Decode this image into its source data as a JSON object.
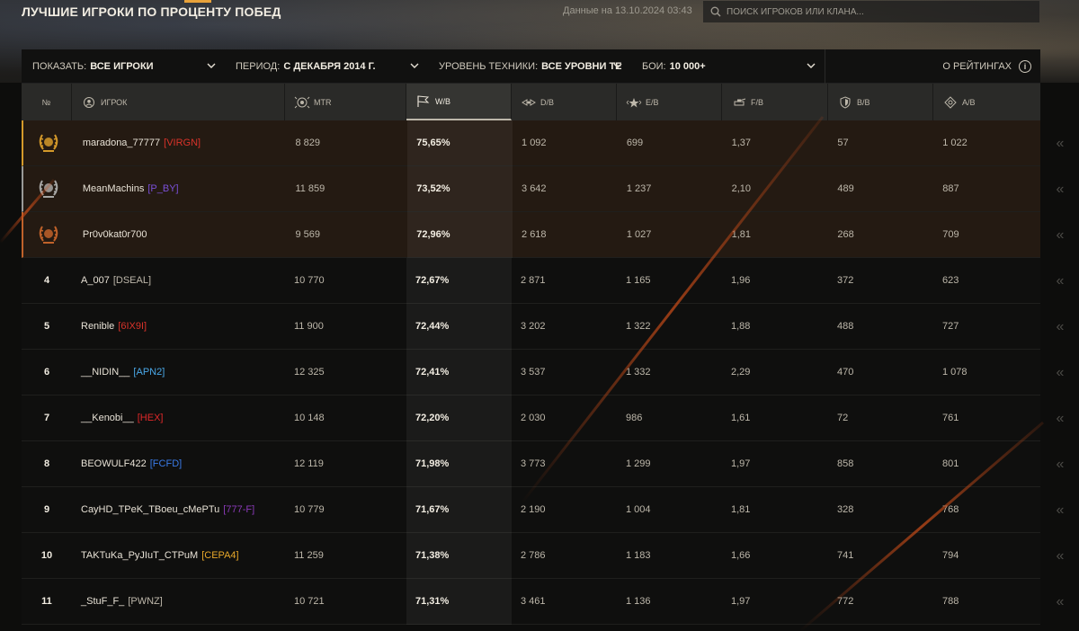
{
  "header": {
    "title": "ЛУЧШИЕ ИГРОКИ ПО ПРОЦЕНТУ ПОБЕД",
    "data_date": "Данные на 13.10.2024 03:43",
    "search_placeholder": "ПОИСК ИГРОКОВ ИЛИ КЛАНА..."
  },
  "filters": {
    "show_label": "ПОКАЗАТЬ:",
    "show_value": "ВСЕ ИГРОКИ",
    "period_label": "ПЕРИОД:",
    "period_value": "С ДЕКАБРЯ 2014 Г.",
    "tier_label": "УРОВЕНЬ ТЕХНИКИ:",
    "tier_value": "ВСЕ УРОВНИ ТЕ",
    "battles_label": "БОИ:",
    "battles_value": "10 000+",
    "about_ratings": "О РЕЙТИНГАХ"
  },
  "columns": {
    "rank": "№",
    "player": "ИГРОК",
    "mtr": "MTR",
    "wb": "W/B",
    "db": "D/B",
    "eb": "E/B",
    "fb": "F/B",
    "bb": "B/B",
    "ab": "A/B"
  },
  "colors": {
    "gold": "#d59a2a",
    "silver": "#9a9a98",
    "bronze": "#c0622a",
    "accent_streak": "#c24a18"
  },
  "rows": [
    {
      "rank": "",
      "medal": "gold-laurel-icon",
      "name": "maradona_77777",
      "clan": "[VIRGN]",
      "clan_color": "#d9332a",
      "mtr": "8 829",
      "wb": "75,65%",
      "db": "1 092",
      "eb": "699",
      "fb": "1,37",
      "bb": "57",
      "ab": "1 022"
    },
    {
      "rank": "",
      "medal": "silver-laurel-icon",
      "name": "MeanMachins",
      "clan": "[P_BY]",
      "clan_color": "#7a4fd8",
      "mtr": "11 859",
      "wb": "73,52%",
      "db": "3 642",
      "eb": "1 237",
      "fb": "2,10",
      "bb": "489",
      "ab": "887"
    },
    {
      "rank": "",
      "medal": "bronze-laurel-icon",
      "name": "Pr0v0kat0r700",
      "clan": "",
      "clan_color": "#bdb7aa",
      "mtr": "9 569",
      "wb": "72,96%",
      "db": "2 618",
      "eb": "1 027",
      "fb": "1,81",
      "bb": "268",
      "ab": "709"
    },
    {
      "rank": "4",
      "medal": "",
      "name": "A_007",
      "clan": "[DSEAL]",
      "clan_color": "#bdb7aa",
      "mtr": "10 770",
      "wb": "72,67%",
      "db": "2 871",
      "eb": "1 165",
      "fb": "1,96",
      "bb": "372",
      "ab": "623"
    },
    {
      "rank": "5",
      "medal": "",
      "name": "Renible",
      "clan": "[6IX9I]",
      "clan_color": "#d9332a",
      "mtr": "11 900",
      "wb": "72,44%",
      "db": "3 202",
      "eb": "1 322",
      "fb": "1,88",
      "bb": "488",
      "ab": "727"
    },
    {
      "rank": "6",
      "medal": "",
      "name": "__NIDIN__",
      "clan": "[APN2]",
      "clan_color": "#4aa8e8",
      "mtr": "12 325",
      "wb": "72,41%",
      "db": "3 537",
      "eb": "1 332",
      "fb": "2,29",
      "bb": "470",
      "ab": "1 078"
    },
    {
      "rank": "7",
      "medal": "",
      "name": "__Kenobi__",
      "clan": "[HEX]",
      "clan_color": "#e0282a",
      "mtr": "10 148",
      "wb": "72,20%",
      "db": "2 030",
      "eb": "986",
      "fb": "1,61",
      "bb": "72",
      "ab": "761"
    },
    {
      "rank": "8",
      "medal": "",
      "name": "BEOWULF422",
      "clan": "[FCFD]",
      "clan_color": "#3a7be8",
      "mtr": "12 119",
      "wb": "71,98%",
      "db": "3 773",
      "eb": "1 299",
      "fb": "1,97",
      "bb": "858",
      "ab": "801"
    },
    {
      "rank": "9",
      "medal": "",
      "name": "CayHD_TPeK_TBoeu_cMePTu",
      "clan": "[777-F]",
      "clan_color": "#8a3ab8",
      "mtr": "10 779",
      "wb": "71,67%",
      "db": "2 190",
      "eb": "1 004",
      "fb": "1,81",
      "bb": "328",
      "ab": "768"
    },
    {
      "rank": "10",
      "medal": "",
      "name": "TAKTuKa_PyJIuT_CTPuM",
      "clan": "[CEPA4]",
      "clan_color": "#e8a82a",
      "mtr": "11 259",
      "wb": "71,38%",
      "db": "2 786",
      "eb": "1 183",
      "fb": "1,66",
      "bb": "741",
      "ab": "794"
    },
    {
      "rank": "11",
      "medal": "",
      "name": "_StuF_F_",
      "clan": "[PWNZ]",
      "clan_color": "#bdb7aa",
      "mtr": "10 721",
      "wb": "71,31%",
      "db": "3 461",
      "eb": "1 136",
      "fb": "1,97",
      "bb": "772",
      "ab": "788"
    }
  ]
}
